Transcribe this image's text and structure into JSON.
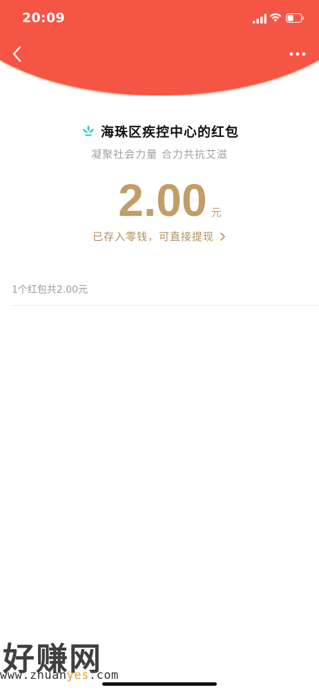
{
  "status_bar": {
    "time": "20:09"
  },
  "colors": {
    "header_red": "#f45545",
    "gold": "#c29d66",
    "muted_text": "#a0a0a0",
    "logo_teal": "#2bc6b8"
  },
  "header": {
    "back_icon": "chevron-left-icon",
    "more_icon": "more-horizontal-icon"
  },
  "envelope": {
    "sender": "海珠区疾控中心的红包",
    "blessing": "凝聚社会力量 合力共抗艾滋",
    "amount": "2.00",
    "unit": "元",
    "stored_notice": "已存入零钱，可直接提现"
  },
  "summary": {
    "text": "1个红包共2.00元"
  },
  "watermark": {
    "title": "好赚网",
    "url_prefix": "www.zhuan",
    "url_highlight": "yes",
    "url_suffix": ".com"
  }
}
